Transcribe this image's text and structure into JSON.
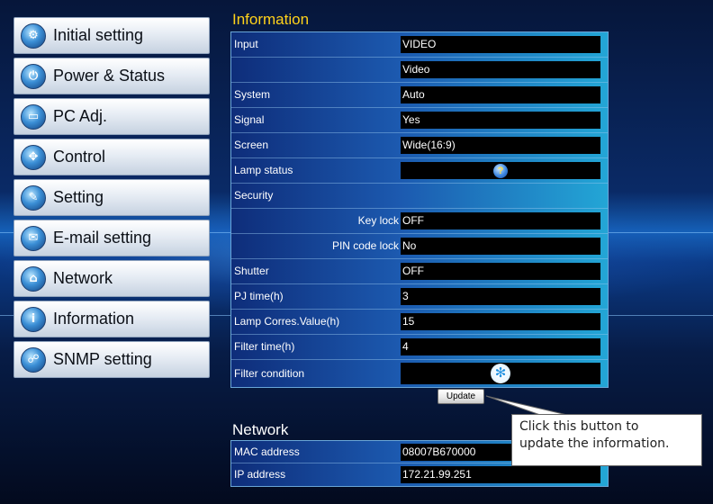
{
  "sidebar": {
    "items": [
      {
        "label": "Initial setting",
        "icon": "gear-icon"
      },
      {
        "label": "Power & Status",
        "icon": "power-icon"
      },
      {
        "label": "PC Adj.",
        "icon": "monitor-icon"
      },
      {
        "label": "Control",
        "icon": "control-pad-icon"
      },
      {
        "label": "Setting",
        "icon": "wrench-icon"
      },
      {
        "label": "E-mail setting",
        "icon": "envelope-icon"
      },
      {
        "label": "Network",
        "icon": "network-icon"
      },
      {
        "label": "Information",
        "icon": "info-icon"
      },
      {
        "label": "SNMP setting",
        "icon": "snmp-icon"
      }
    ]
  },
  "info": {
    "title": "Information",
    "rows": {
      "input_label": "Input",
      "input_value": "VIDEO",
      "input_value2": "Video",
      "system_label": "System",
      "system_value": "Auto",
      "signal_label": "Signal",
      "signal_value": "Yes",
      "screen_label": "Screen",
      "screen_value": "Wide(16:9)",
      "lamp_label": "Lamp status",
      "security_label": "Security",
      "keylock_label": "Key lock",
      "keylock_value": "OFF",
      "pinlock_label": "PIN code lock",
      "pinlock_value": "No",
      "shutter_label": "Shutter",
      "shutter_value": "OFF",
      "pjtime_label": "PJ time(h)",
      "pjtime_value": "3",
      "lampcorr_label": "Lamp Corres.Value(h)",
      "lampcorr_value": "15",
      "filtertime_label": "Filter time(h)",
      "filtertime_value": "4",
      "filtercond_label": "Filter condition"
    },
    "update_label": "Update"
  },
  "network": {
    "title": "Network",
    "mac_label": "MAC address",
    "mac_value": "08007B670000",
    "ip_label": "IP address",
    "ip_value": "172.21.99.251"
  },
  "callout": {
    "text_line1": "Click this button to",
    "text_line2": "update the information."
  },
  "colors": {
    "title_accent": "#ffd21a",
    "value_box": "#000000",
    "panel_gradient_start": "#0e2d7a",
    "panel_gradient_end": "#23a6d6"
  }
}
